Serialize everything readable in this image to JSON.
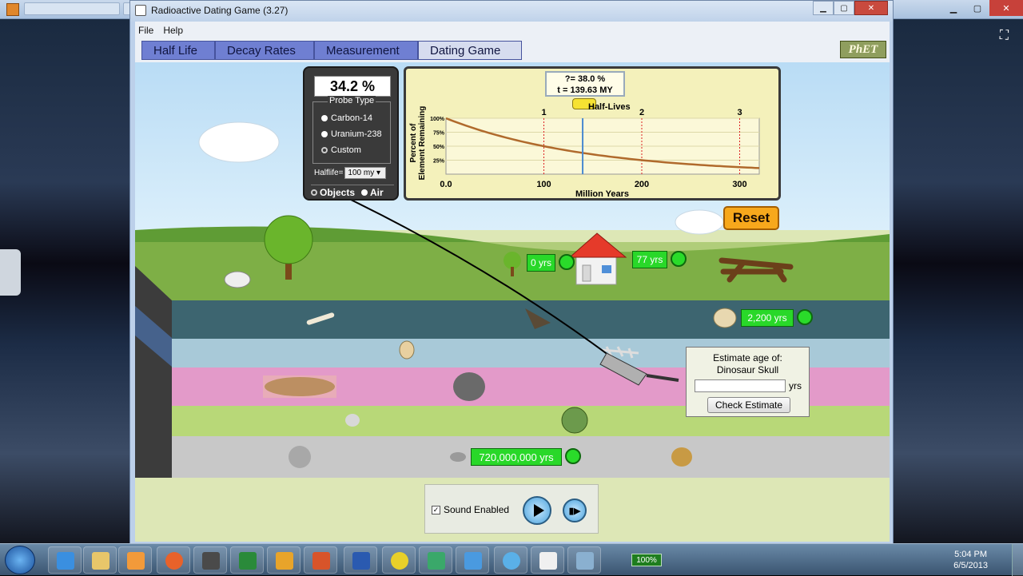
{
  "window": {
    "title": "Radioactive Dating Game (3.27)"
  },
  "menu": [
    "File",
    "Help"
  ],
  "tabs": [
    {
      "label": "Half Life",
      "active": false
    },
    {
      "label": "Decay Rates",
      "active": false
    },
    {
      "label": "Measurement",
      "active": false
    },
    {
      "label": "Dating Game",
      "active": true
    }
  ],
  "brand": "PhET",
  "probe": {
    "reading": "34.2 %",
    "title": "Probe Type",
    "options": [
      "Carbon-14",
      "Uranium-238",
      "Custom"
    ],
    "selected": "Custom",
    "halflife_label": "Halflife=",
    "halflife_value": "100 my",
    "target_options": [
      "Objects",
      "Air"
    ],
    "target_selected": "Objects"
  },
  "graph": {
    "readout_line1": "?= 38.0 %",
    "readout_line2": "t = 139.63 MY",
    "half_lives_label": "Half-Lives",
    "ylabel_line1": "Percent of",
    "ylabel_line2": "Element Remaining",
    "xlabel": "Million Years",
    "x_ticks": [
      "0.0",
      "100",
      "200",
      "300"
    ],
    "y_ticks": [
      "100%",
      "75%",
      "50%",
      "25%"
    ],
    "half_life_marks": [
      "1",
      "2",
      "3"
    ]
  },
  "chart_data": {
    "type": "line",
    "xlabel": "Million Years",
    "ylabel": "Percent of Element Remaining",
    "xlim": [
      0,
      320
    ],
    "ylim": [
      0,
      100
    ],
    "half_life": 100,
    "x": [
      0,
      40,
      80,
      120,
      160,
      200,
      240,
      280,
      320
    ],
    "values": [
      100,
      75.8,
      57.4,
      43.5,
      33.0,
      25.0,
      18.9,
      14.4,
      12.5
    ],
    "cursor_x": 139.63
  },
  "reset_label": "Reset",
  "ages": {
    "tree_small": "0 yrs",
    "house": "77 yrs",
    "skull_human": "2,200 yrs",
    "rock_bottom": "720,000,000 yrs"
  },
  "estimate": {
    "prompt_line1": "Estimate age of:",
    "prompt_line2": "Dinosaur Skull",
    "units": "yrs",
    "button": "Check Estimate",
    "value": ""
  },
  "controls": {
    "sound_label": "Sound Enabled",
    "sound_checked": true
  },
  "taskbar": {
    "battery": "100%",
    "time": "5:04 PM",
    "date": "6/5/2013"
  }
}
